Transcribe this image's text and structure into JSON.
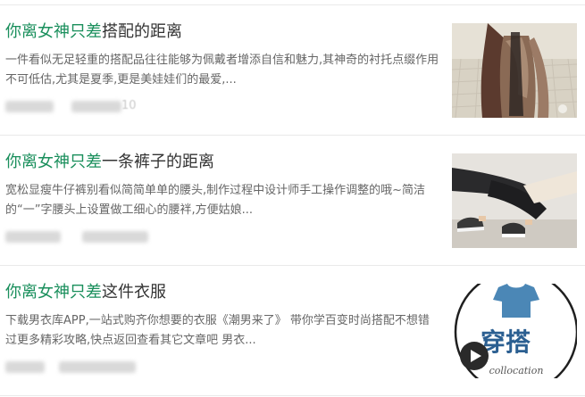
{
  "articles": [
    {
      "title_highlight": "你离女神只差",
      "title_rest": "搭配的距离",
      "summary": "一件看似无足轻重的搭配品往往能够为佩戴者增添自信和魅力,其神奇的衬托点缀作用不可低估,尤其是夏季,更是美娃娃们的最爱,...",
      "meta_visible": "10",
      "thumbnail_icon": "woman-fashion-photo",
      "has_play_button": false
    },
    {
      "title_highlight": "你离女神只差",
      "title_rest": "一条裤子的距离",
      "summary": "宽松显瘦牛仔裤别看似简简单单的腰头,制作过程中设计师手工操作调整的哦~简洁的“一”字腰头上设置做工细心的腰袢,方便姑娘...",
      "meta_visible": "",
      "thumbnail_icon": "jogger-pants-photo",
      "has_play_button": false
    },
    {
      "title_highlight": "你离女神只差",
      "title_rest": "这件衣服",
      "summary": "下载男衣库APP,一站式购齐你想要的衣服《潮男来了》 带你学百变时尚搭配不想错过更多精彩攻略,快点返回查看其它文章吧 男衣...",
      "meta_visible": "",
      "thumbnail_icon": "chuanda-collocation-logo",
      "thumb_text_main": "穿搭",
      "thumb_text_sub": "collocation",
      "has_play_button": true
    }
  ],
  "colors": {
    "title_highlight": "#1a8f5c",
    "title_text": "#333333",
    "summary_text": "#666666",
    "divider": "#e9e9e9"
  }
}
